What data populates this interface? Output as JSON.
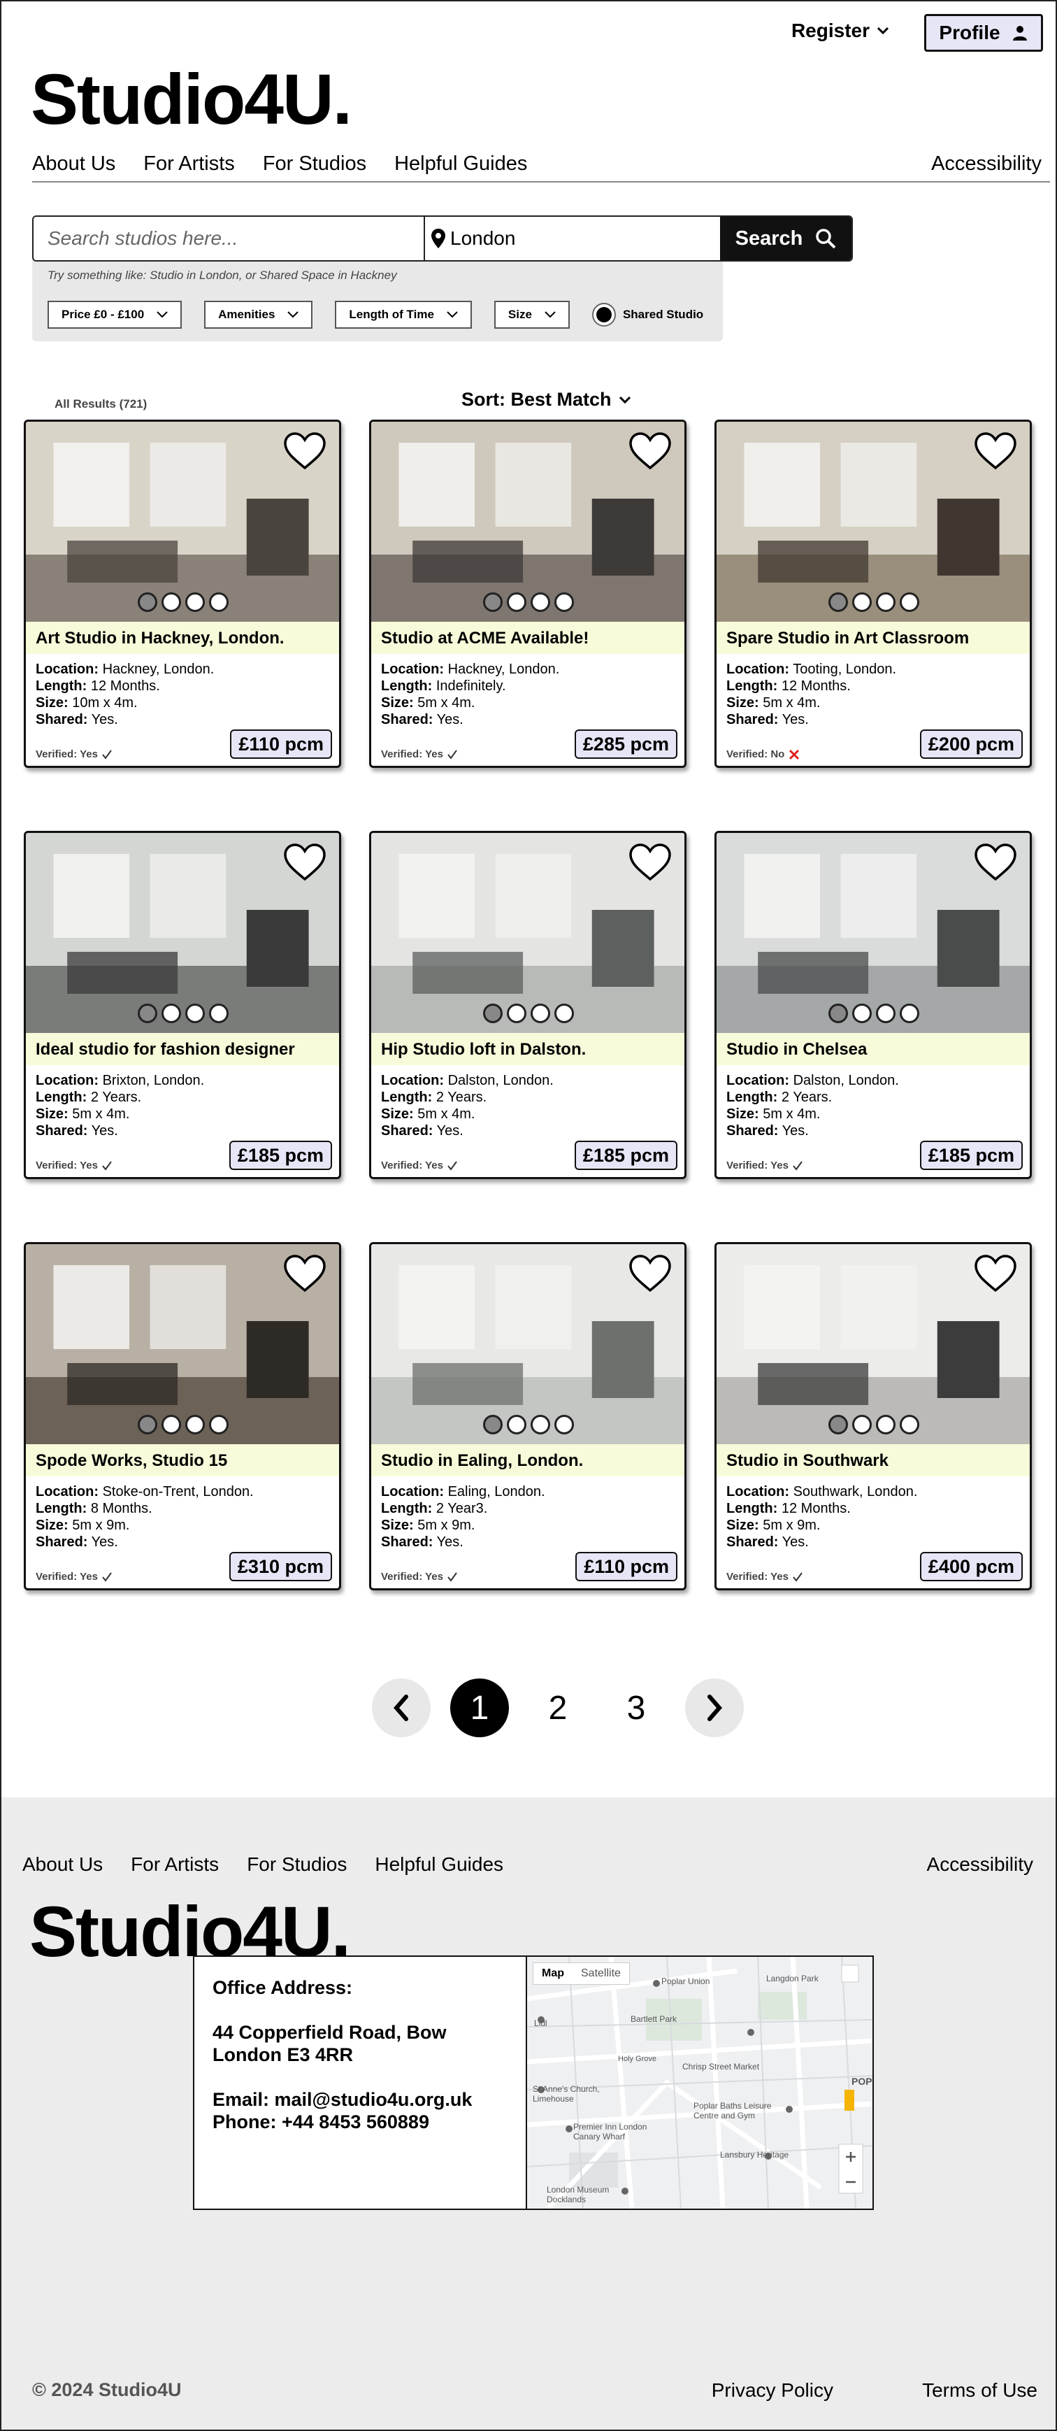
{
  "header": {
    "register_label": "Register",
    "profile_label": "Profile",
    "logo": "Studio4U."
  },
  "nav": {
    "items": [
      "About Us",
      "For Artists",
      "For Studios",
      "Helpful Guides"
    ],
    "accessibility": "Accessibility"
  },
  "search": {
    "placeholder": "Search studios here...",
    "location_value": "London",
    "button_label": "Search",
    "hint": "Try something like: Studio in London, or Shared Space in Hackney",
    "filters": [
      "Price £0 - £100",
      "Amenities",
      "Length of Time",
      "Size"
    ],
    "shared_label": "Shared Studio"
  },
  "results": {
    "count_label": "All Results (721)",
    "sort_label": "Sort: Best Match"
  },
  "labels": {
    "location": "Location:",
    "length": "Length:",
    "size": "Size:",
    "shared": "Shared:"
  },
  "cards": [
    {
      "title": "Art Studio in Hackney, London.",
      "location": "Hackney, London.",
      "length": "12 Months.",
      "size": "10m x 4m.",
      "shared": "Yes.",
      "verified": "Verified: Yes",
      "verified_ok": true,
      "price": "£110 pcm",
      "active_dot": 0
    },
    {
      "title": "Studio at ACME Available!",
      "location": "Hackney, London.",
      "length": "Indefinitely.",
      "size": "5m x 4m.",
      "shared": "Yes.",
      "verified": "Verified: Yes",
      "verified_ok": true,
      "price": "£285 pcm",
      "active_dot": 0
    },
    {
      "title": "Spare Studio in Art Classroom",
      "location": "Tooting, London.",
      "length": "12 Months.",
      "size": "5m x 4m.",
      "shared": "Yes.",
      "verified": "Verified: No",
      "verified_ok": false,
      "price": "£200 pcm",
      "active_dot": 0
    },
    {
      "title": "Ideal studio for fashion designer",
      "location": "Brixton, London.",
      "length": "2 Years.",
      "size": "5m x 4m.",
      "shared": "Yes.",
      "verified": "Verified: Yes",
      "verified_ok": true,
      "price": "£185 pcm",
      "active_dot": 0
    },
    {
      "title": "Hip Studio loft in Dalston.",
      "location": "Dalston, London.",
      "length": "2 Years.",
      "size": "5m x 4m.",
      "shared": "Yes.",
      "verified": "Verified: Yes",
      "verified_ok": true,
      "price": "£185 pcm",
      "active_dot": 0
    },
    {
      "title": "Studio in Chelsea",
      "location": "Dalston, London.",
      "length": "2 Years.",
      "size": "5m x 4m.",
      "shared": "Yes.",
      "verified": "Verified: Yes",
      "verified_ok": true,
      "price": "£185 pcm",
      "active_dot": 0
    },
    {
      "title": "Spode Works, Studio 15",
      "location": "Stoke-on-Trent, London.",
      "length": "8 Months.",
      "size": "5m x 9m.",
      "shared": "Yes.",
      "verified": "Verified: Yes",
      "verified_ok": true,
      "price": "£310 pcm",
      "active_dot": 0
    },
    {
      "title": "Studio in Ealing, London.",
      "location": "Ealing, London.",
      "length": "2 Year3.",
      "size": "5m x 9m.",
      "shared": "Yes.",
      "verified": "Verified: Yes",
      "verified_ok": true,
      "price": "£110 pcm",
      "active_dot": 0
    },
    {
      "title": "Studio in Southwark",
      "location": "Southwark, London.",
      "length": "12 Months.",
      "size": "5m x 9m.",
      "shared": "Yes.",
      "verified": "Verified: Yes",
      "verified_ok": true,
      "price": "£400 pcm",
      "active_dot": 0
    }
  ],
  "pagination": {
    "pages": [
      "1",
      "2",
      "3"
    ],
    "current": "1"
  },
  "footer": {
    "nav": [
      "About Us",
      "For Artists",
      "For Studios",
      "Helpful Guides"
    ],
    "accessibility": "Accessibility",
    "address_title": "Office Address:",
    "address_line1": "44 Copperfield Road, Bow",
    "address_line2": "London E3 4RR",
    "email": "Email: mail@studio4u.org.uk",
    "phone": "Phone: +44 8453 560889",
    "map_tab_map": "Map",
    "map_tab_satellite": "Satellite",
    "map_labels": [
      "Poplar Union",
      "Langdon Park",
      "Bartlett Park",
      "Lidl",
      "Holy Grove",
      "Chrisp Street Market",
      "St Anne's Church, Limehouse",
      "Poplar Baths Leisure Centre and Gym",
      "Premier Inn London Canary Wharf",
      "Lansbury Heritage",
      "London Museum Docklands",
      "POP"
    ],
    "logo": "Studio4U.",
    "copyright": "© 2024 Studio4U",
    "privacy": "Privacy Policy",
    "terms": "Terms of Use"
  },
  "colors": {
    "price_bg": "#e6e6f7",
    "title_bg": "#f7fbd9",
    "footer_bg": "#ececec",
    "verified_no": "#e02020"
  }
}
